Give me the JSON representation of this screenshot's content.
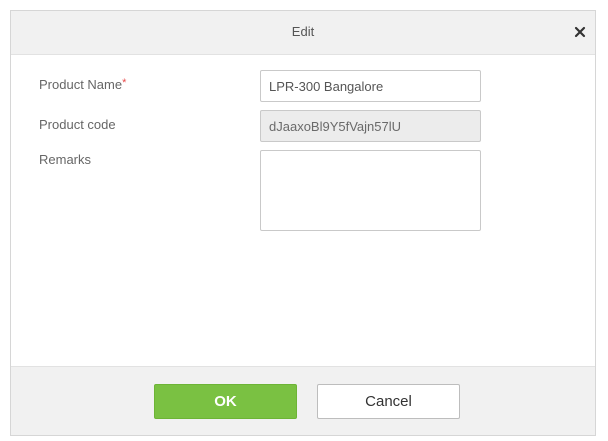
{
  "dialog": {
    "title": "Edit",
    "close_icon": "close-icon"
  },
  "form": {
    "product_name": {
      "label": "Product Name",
      "required_mark": "*",
      "value": "LPR-300 Bangalore"
    },
    "product_code": {
      "label": "Product code",
      "value": "dJaaxoBl9Y5fVajn57lU"
    },
    "remarks": {
      "label": "Remarks",
      "value": ""
    }
  },
  "footer": {
    "ok_label": "OK",
    "cancel_label": "Cancel"
  },
  "colors": {
    "accent_ok": "#7ac142",
    "required": "#e84a4a"
  }
}
